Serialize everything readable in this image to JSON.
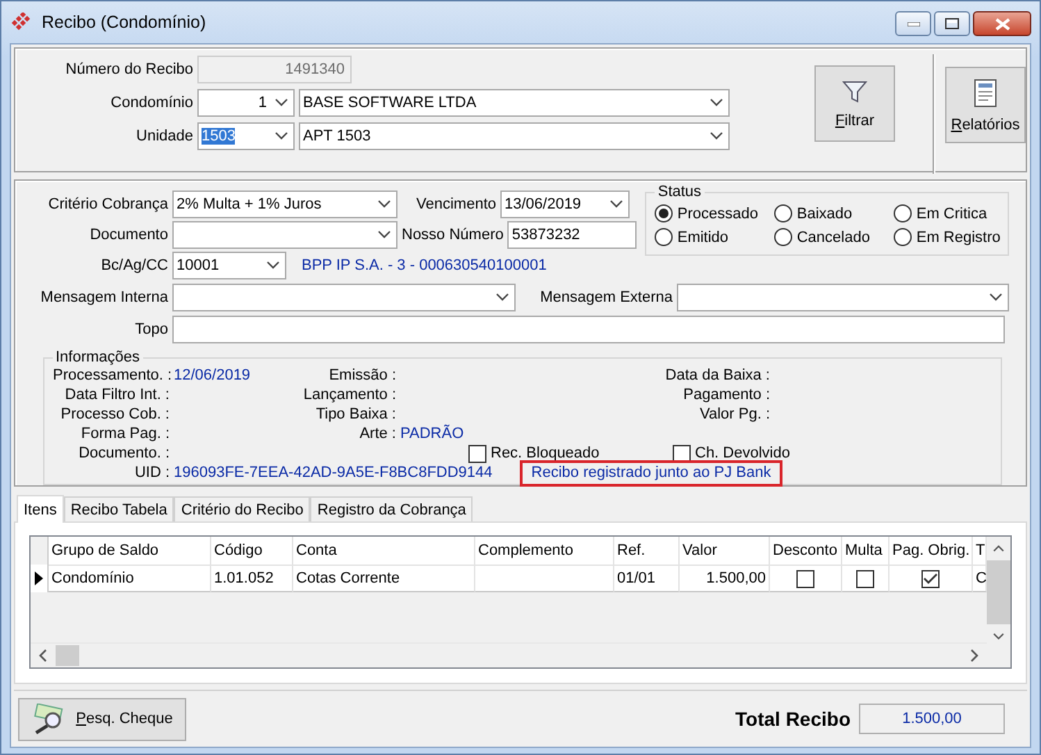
{
  "window": {
    "title": "Recibo (Condomínio)"
  },
  "header": {
    "numero": {
      "label": "Número do Recibo",
      "value": "1491340",
      "disabled": true
    },
    "condominio": {
      "label": "Condomínio",
      "code": "1",
      "name": "BASE SOFTWARE LTDA"
    },
    "unidade": {
      "label": "Unidade",
      "code": "1503",
      "name": "APT 1503",
      "code_text_selected": true
    },
    "filter_button": "Filtrar",
    "reports_button": "Relatórios"
  },
  "billing": {
    "criterio": {
      "label": "Critério Cobrança",
      "value": "2% Multa + 1% Juros"
    },
    "vencimento": {
      "label": "Vencimento",
      "value": "13/06/2019"
    },
    "documento": {
      "label": "Documento"
    },
    "nosso_numero": {
      "label": "Nosso Número",
      "value": "53873232"
    },
    "bank": {
      "label": "Bc/Ag/CC",
      "value": "10001",
      "description": "BPP IP S.A. - 3 - 000630540100001"
    },
    "mensagem_interna": {
      "label": "Mensagem Interna"
    },
    "mensagem_externa": {
      "label": "Mensagem Externa"
    },
    "topo": {
      "label": "Topo"
    }
  },
  "status": {
    "title": "Status",
    "options": [
      {
        "label": "Processado",
        "selected": true
      },
      {
        "label": "Baixado",
        "selected": false
      },
      {
        "label": "Em Critica",
        "selected": false
      },
      {
        "label": "Emitido",
        "selected": false
      },
      {
        "label": "Cancelado",
        "selected": false
      },
      {
        "label": "Em Registro",
        "selected": false
      }
    ]
  },
  "info": {
    "title": "Informações",
    "rows": [
      [
        {
          "kind": "field",
          "label": "Processamento. :",
          "value": "12/06/2019"
        },
        {
          "kind": "field",
          "label": "Emissão :"
        },
        {
          "kind": "field",
          "label": "Data da Baixa :"
        }
      ],
      [
        {
          "kind": "field",
          "label": "Data Filtro Int. :"
        },
        {
          "kind": "field",
          "label": "Lançamento :"
        },
        {
          "kind": "field",
          "label": "Pagamento :"
        }
      ],
      [
        {
          "kind": "field",
          "label": "Processo Cob. :"
        },
        {
          "kind": "field",
          "label": "Tipo Baixa :"
        },
        {
          "kind": "field",
          "label": "Valor Pg. :"
        }
      ],
      [
        {
          "kind": "field",
          "label": "Forma Pag. :"
        },
        {
          "kind": "field",
          "label": "Arte :",
          "value": "PADRÃO"
        }
      ],
      [
        {
          "kind": "field",
          "label": "Documento. :"
        },
        {
          "kind": "checkbox",
          "label": "Rec. Bloqueado",
          "checked": false
        },
        {
          "kind": "checkbox",
          "label": "Ch. Devolvido",
          "checked": false
        }
      ],
      [
        {
          "kind": "field",
          "label": "UID :",
          "value": "196093FE-7EEA-42AD-9A5E-F8BC8FDD9144"
        },
        {
          "kind": "notice",
          "text": "Recibo registrado junto ao PJ Bank"
        }
      ]
    ]
  },
  "tabs": [
    {
      "label": "Itens",
      "selected": true
    },
    {
      "label": "Recibo Tabela",
      "selected": false
    },
    {
      "label": "Critério do Recibo",
      "selected": false
    },
    {
      "label": "Registro da Cobrança",
      "selected": false
    }
  ],
  "table": {
    "columns": [
      "Grupo de Saldo",
      "Código",
      "Conta",
      "Complemento",
      "Ref.",
      "Valor",
      "Desconto",
      "Multa",
      "Pag. Obrig.",
      "T"
    ],
    "rows": [
      {
        "current": true,
        "grupo": "Condomínio",
        "codigo": "1.01.052",
        "conta": "Cotas Corrente",
        "ref": "01/01",
        "valor": "1.500,00",
        "desconto": false,
        "multa": false,
        "pag_obrig": true,
        "column_10": "C"
      }
    ]
  },
  "footer": {
    "search_button": "Pesq. Cheque",
    "total_label": "Total Recibo",
    "total_value": "1.500,00"
  }
}
